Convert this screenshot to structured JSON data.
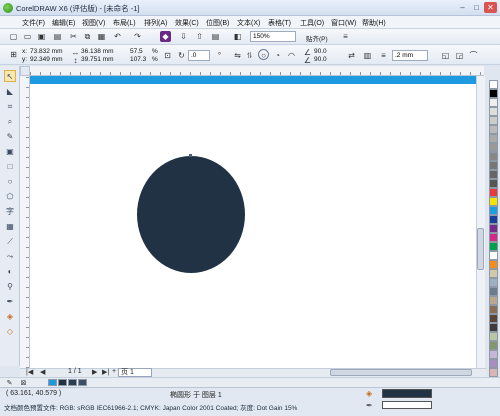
{
  "window": {
    "title": "CorelDRAW X6 (评估版) - [未命名 -1]",
    "minimize": "–",
    "maximize": "□",
    "close": "✕"
  },
  "menu": {
    "items": [
      "文件(F)",
      "编辑(E)",
      "视图(V)",
      "布局(L)",
      "排列(A)",
      "效果(C)",
      "位图(B)",
      "文本(X)",
      "表格(T)",
      "工具(O)",
      "窗口(W)",
      "帮助(H)"
    ]
  },
  "toolbar1": {
    "zoom_value": "150%",
    "snap_label": "贴齐(P)"
  },
  "toolbar2": {
    "x_label": "x:",
    "x_value": "73.832 mm",
    "y_label": "y:",
    "y_value": "92.349 mm",
    "width_value": "36.138 mm",
    "height_value": "39.751 mm",
    "scale_x": "57.5",
    "scale_y": "107.3",
    "percent": "%",
    "rotation_value": ".0",
    "angle_start": "90.0",
    "angle_end": "90.0",
    "outline_width": ".2 mm"
  },
  "toolbox": {
    "icons": [
      "pick-tool-icon",
      "shape-tool-icon",
      "crop-tool-icon",
      "zoom-tool-icon",
      "freehand-tool-icon",
      "smart-fill-icon",
      "rectangle-tool-icon",
      "ellipse-tool-icon",
      "polygon-tool-icon",
      "text-tool-icon",
      "table-tool-icon",
      "parallel-dimension-icon",
      "connector-tool-icon",
      "blend-tool-icon",
      "eyedropper-tool-icon",
      "outline-pen-icon",
      "fill-tool-icon",
      "interactive-fill-icon"
    ]
  },
  "pagebar": {
    "first": "|◀",
    "prev": "◀",
    "counter": "1 / 1",
    "next": "▶",
    "last": "▶|",
    "add": "+",
    "page_tab": "页 1"
  },
  "status": {
    "coords": "( 63.161, 40.579 )",
    "object_info": "椭圆形 于 图层 1",
    "profile": "文档颜色预置文件: RGB: sRGB IEC61966-2.1; CMYK: Japan Color 2001 Coated; 灰度: Dot Gain 15%"
  },
  "colors": {
    "shape_fill": "#203244",
    "top_band": "#1e9be0",
    "palette": [
      "#ffffff",
      "#000000",
      "#eeeeee",
      "#dddddd",
      "#cccccc",
      "#bbbbbb",
      "#aaaaaa",
      "#999999",
      "#888888",
      "#777777",
      "#666666",
      "#555555",
      "#e83a3a",
      "#f4e500",
      "#1c9fe0",
      "#1a3f9a",
      "#7a2a8c",
      "#d12a89",
      "#00a14b",
      "#ffffff",
      "#f08d1e",
      "#d3c9a8",
      "#9fb0c2",
      "#6c7c8c",
      "#bca78f",
      "#8a6d57",
      "#5c4537",
      "#3f3b3a",
      "#b9c6a3",
      "#83976b",
      "#c9b5d6",
      "#a98dc0",
      "#d9b6b6"
    ],
    "document_palette": [
      "#1e9be0",
      "#203244",
      "#2a3c50",
      "#3b4e63"
    ]
  }
}
